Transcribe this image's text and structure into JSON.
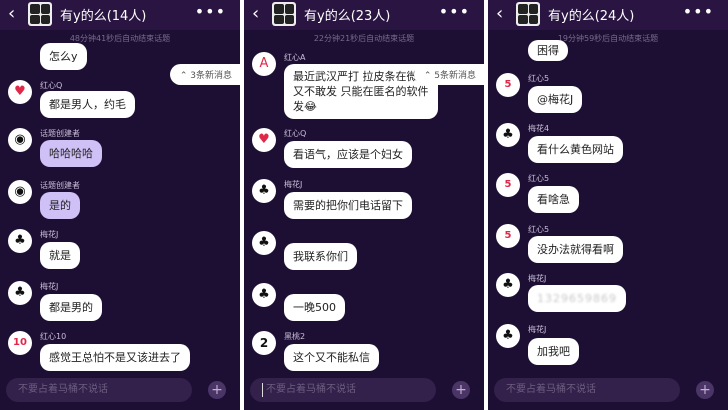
{
  "panels": [
    {
      "title": "有y的么(14人)",
      "notice": "48分钟41秒后自动结束话题",
      "new_msgs": "3条新消息",
      "input_placeholder": "不要占着马桶不说话",
      "messages": [
        {
          "name": "",
          "text": "怎么y",
          "avatar": "",
          "style": "white"
        },
        {
          "name": "红心Q",
          "text": "都是男人，约毛",
          "avatar": "♥",
          "style": "white"
        },
        {
          "name": "话题创建者",
          "text": "哈哈哈哈",
          "avatar": "◉",
          "style": "purple"
        },
        {
          "name": "话题创建者",
          "text": "是的",
          "avatar": "◉",
          "style": "purple"
        },
        {
          "name": "梅花J",
          "text": "就是",
          "avatar": "♣",
          "style": "white"
        },
        {
          "name": "梅花J",
          "text": "都是男的",
          "avatar": "♣",
          "style": "white"
        },
        {
          "name": "红心10",
          "text": "感觉王总怕不是又该进去了",
          "avatar": "10",
          "style": "white"
        }
      ]
    },
    {
      "title": "有y的么(23人)",
      "notice": "22分钟21秒后自动结束话题",
      "new_msgs": "5条新消息",
      "input_placeholder": "不要占着马桶不说话",
      "messages": [
        {
          "name": "红心A",
          "text_lines": [
            "最近武汉严打 拉皮条在微",
            "又不敢发 只能在匿名的软件",
            "发😂"
          ],
          "avatar": "A",
          "style": "white"
        },
        {
          "name": "红心Q",
          "text": "看语气，应该是个妇女",
          "avatar": "♥",
          "style": "white"
        },
        {
          "name": "梅花J",
          "text": "需要的把你们电话留下",
          "avatar": "♣",
          "style": "white"
        },
        {
          "name": "",
          "text": "我联系你们",
          "avatar": "♣",
          "style": "white"
        },
        {
          "name": "",
          "text": "一晚500",
          "avatar": "♣",
          "style": "white"
        },
        {
          "name": "黑桃2",
          "text": "这个又不能私信",
          "avatar": "2",
          "style": "white"
        }
      ]
    },
    {
      "title": "有y的么(24人)",
      "notice": "19分钟59秒后自动结束话题",
      "input_placeholder": "不要占着马桶不说话",
      "messages": [
        {
          "name": "",
          "text": "困得",
          "avatar": "",
          "style": "white"
        },
        {
          "name": "红心5",
          "text": "@梅花J",
          "avatar": "5",
          "style": "white"
        },
        {
          "name": "梅花4",
          "text": "看什么黄色网站",
          "avatar": "♣",
          "style": "white"
        },
        {
          "name": "红心5",
          "text": "看啥急",
          "avatar": "5",
          "style": "white"
        },
        {
          "name": "红心5",
          "text": "没办法就得看啊",
          "avatar": "5",
          "style": "white"
        },
        {
          "name": "梅花J",
          "text": "1329659869",
          "avatar": "♣",
          "style": "blur"
        },
        {
          "name": "梅花J",
          "text": "加我吧",
          "avatar": "♣",
          "style": "white"
        }
      ]
    }
  ]
}
